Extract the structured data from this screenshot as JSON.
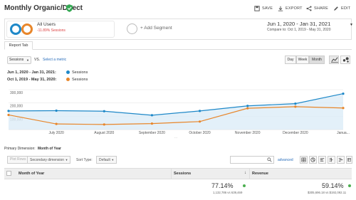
{
  "header": {
    "title": "Monthly Organic/Direct",
    "actions": [
      {
        "label": "SAVE",
        "icon": "save-icon"
      },
      {
        "label": "EXPORT",
        "icon": "export-icon"
      },
      {
        "label": "SHARE",
        "icon": "share-icon"
      },
      {
        "label": "EDIT",
        "icon": "edit-icon"
      }
    ]
  },
  "segments": {
    "all_users": {
      "name": "All Users",
      "change": "-11.89% Sessions"
    },
    "add_label": "+ Add Segment"
  },
  "date": {
    "range": "Jun 1, 2020 - Jan 31, 2021",
    "compare": "Compare to: Oct 1, 2019 - May 31, 2020"
  },
  "tabs": {
    "report": "Report Tab"
  },
  "controls": {
    "metric": "Sessions",
    "vs": "VS.",
    "select_metric": "Select a metric",
    "granularity": [
      "Day",
      "Week",
      "Month"
    ]
  },
  "legend": [
    {
      "range": "Jun 1, 2020 - Jan 31, 2021:",
      "name": "Sessions",
      "color": "#1e88c8"
    },
    {
      "range": "Oct 1, 2019 - May 31, 2020:",
      "name": "Sessions",
      "color": "#e8862a"
    }
  ],
  "chart_data": {
    "type": "line",
    "categories": [
      "Jun 2020",
      "July 2020",
      "August 2020",
      "September 2020",
      "October 2020",
      "November 2020",
      "December 2020",
      "Janua..."
    ],
    "x_tick_labels": [
      "July 2020",
      "August 2020",
      "September 2020",
      "October 2020",
      "November 2020",
      "December 2020",
      "Janua..."
    ],
    "y_tick_labels": [
      "300,000",
      "200,000",
      "100,000"
    ],
    "ylim": [
      0,
      300000
    ],
    "series": [
      {
        "color": "#1e88c8",
        "values": [
          140000,
          142000,
          138000,
          108000,
          140000,
          178000,
          195000,
          270000
        ]
      },
      {
        "color": "#e8862a",
        "values": [
          110000,
          42000,
          38000,
          45000,
          60000,
          160000,
          172000,
          162000
        ]
      }
    ]
  },
  "primary_dimension": {
    "label": "Primary Dimension:",
    "value": "Month of Year"
  },
  "table_toolbar": {
    "plot_rows": "Plot Rows",
    "secondary": "Secondary dimension",
    "sort_label": "Sort Type:",
    "sort_value": "Default",
    "advanced": "advanced"
  },
  "table": {
    "headers": [
      "Month of Year",
      "Sessions",
      "Revenue"
    ],
    "totals": [
      {
        "pct": "77.14%",
        "detail": "1,132,786 vs 639,469"
      },
      {
        "pct": "59.14%",
        "detail": "$305,696.18 vs $192,092.11"
      }
    ]
  }
}
